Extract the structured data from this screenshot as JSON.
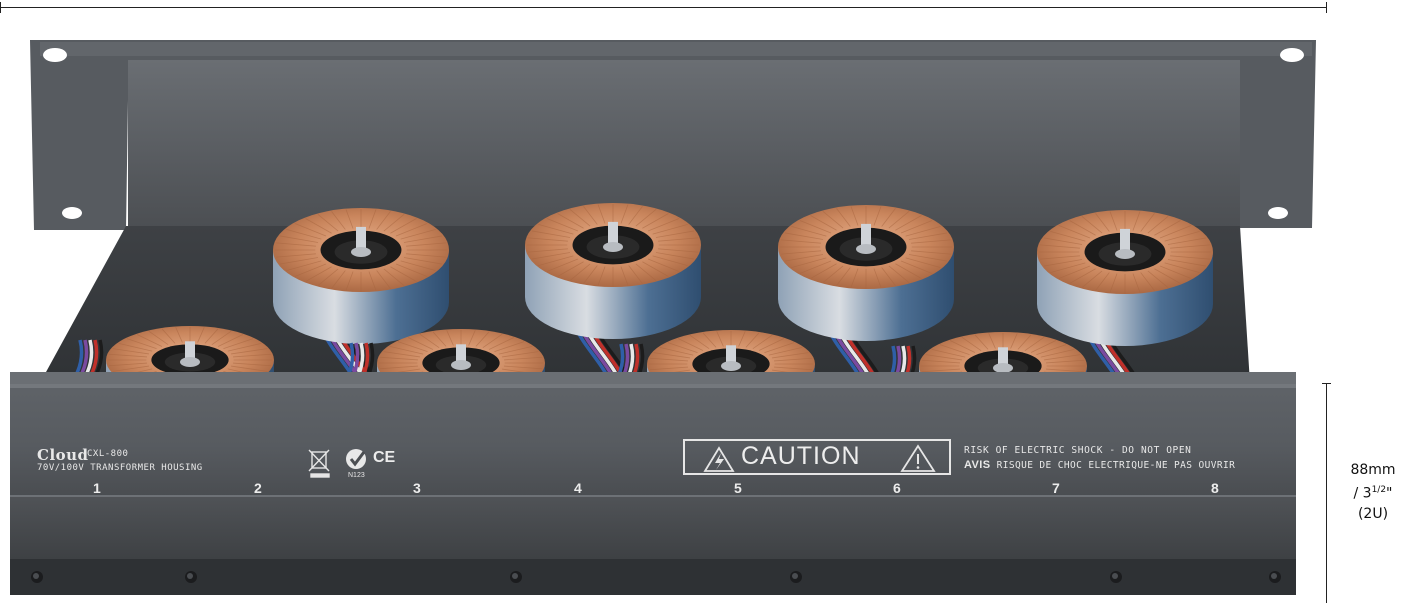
{
  "dimensions": {
    "metric": "88mm",
    "imperial_prefix": "/ 3",
    "imperial_fraction": "1/2",
    "imperial_suffix": "\"",
    "units": "(2U)"
  },
  "panel": {
    "brand": "Cloud",
    "model": "CXL-800",
    "description": "70V/100V TRANSFORMER HOUSING",
    "compliance_code": "N123",
    "ce_mark": "CE",
    "caution": "CAUTION",
    "warning_en": "RISK OF ELECTRIC SHOCK - DO NOT OPEN",
    "warning_fr_lead": "AVIS",
    "warning_fr": "RISQUE DE CHOC ELECTRIQUE-NE PAS OUVRIR",
    "channels": [
      "1",
      "2",
      "3",
      "4",
      "5",
      "6",
      "7",
      "8"
    ]
  },
  "colors": {
    "chassis": "#55595e",
    "chassis_dark": "#3c3f43",
    "copper": "#c07a55",
    "tape_blue": "#3d5f86",
    "background": "#ffffff"
  }
}
